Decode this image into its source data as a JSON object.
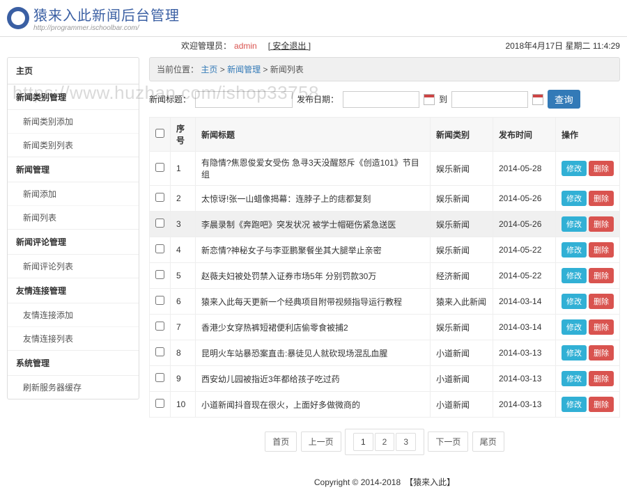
{
  "header": {
    "title": "猿来入此新闻后台管理",
    "url": "http://programmer.ischoolbar.com/"
  },
  "welcome": {
    "prefix": "欢迎管理员：",
    "admin": "admin",
    "logout": "[ 安全退出 ]",
    "datetime": "2018年4月17日 星期二 11:4:29"
  },
  "sidebar": {
    "home": "主页",
    "groups": [
      {
        "title": "新闻类别管理",
        "items": [
          "新闻类别添加",
          "新闻类别列表"
        ]
      },
      {
        "title": "新闻管理",
        "items": [
          "新闻添加",
          "新闻列表"
        ]
      },
      {
        "title": "新闻评论管理",
        "items": [
          "新闻评论列表"
        ]
      },
      {
        "title": "友情连接管理",
        "items": [
          "友情连接添加",
          "友情连接列表"
        ]
      },
      {
        "title": "系统管理",
        "items": [
          "刷新服务器缓存"
        ]
      }
    ]
  },
  "breadcrumb": {
    "label": "当前位置：",
    "home": "主页",
    "sep": " > ",
    "l1": "新闻管理",
    "l2": "新闻列表"
  },
  "search": {
    "title_label": "新闻标题：",
    "title_value": "",
    "date_label": "发布日期：",
    "date_from": "",
    "to_label": "到",
    "date_to": "",
    "query": "查询"
  },
  "table": {
    "headers": {
      "chk": "",
      "idx": "序号",
      "title": "新闻标题",
      "cat": "新闻类别",
      "date": "发布时间",
      "ops": "操作"
    },
    "ops": {
      "edit": "修改",
      "del": "删除"
    },
    "rows": [
      {
        "idx": "1",
        "title": "有隐情?焦恩俊爱女受伤 急寻3天没醒怒斥《创造101》节目组",
        "cat": "娱乐新闻",
        "date": "2014-05-28"
      },
      {
        "idx": "2",
        "title": "太惊讶!张一山蜡像揭幕：连脖子上的痣都复刻",
        "cat": "娱乐新闻",
        "date": "2014-05-26"
      },
      {
        "idx": "3",
        "title": "李晨录制《奔跑吧》突发状况 被学士帽砸伤紧急送医",
        "cat": "娱乐新闻",
        "date": "2014-05-26",
        "hl": true
      },
      {
        "idx": "4",
        "title": "新恋情?神秘女子与李亚鹏聚餐坐其大腿举止亲密",
        "cat": "娱乐新闻",
        "date": "2014-05-22"
      },
      {
        "idx": "5",
        "title": "赵薇夫妇被处罚禁入证券市场5年 分别罚款30万",
        "cat": "经济新闻",
        "date": "2014-05-22"
      },
      {
        "idx": "6",
        "title": "猿来入此每天更新一个经典项目附带视频指导运行教程",
        "cat": "猿来入此新闻",
        "date": "2014-03-14"
      },
      {
        "idx": "7",
        "title": "香港少女穿热裤短裙便利店偷零食被捕2",
        "cat": "娱乐新闻",
        "date": "2014-03-14"
      },
      {
        "idx": "8",
        "title": "昆明火车站暴恐案直击:暴徒见人就砍现场混乱血腥",
        "cat": "小道新闻",
        "date": "2014-03-13"
      },
      {
        "idx": "9",
        "title": "西安幼儿园被指近3年都给孩子吃过药",
        "cat": "小道新闻",
        "date": "2014-03-13"
      },
      {
        "idx": "10",
        "title": "小道新闻抖音现在很火，上面好多做微商的",
        "cat": "小道新闻",
        "date": "2014-03-13"
      }
    ]
  },
  "pager": {
    "first": "首页",
    "prev": "上一页",
    "pages": [
      "1",
      "2",
      "3"
    ],
    "next": "下一页",
    "last": "尾页",
    "current": "1"
  },
  "footer": {
    "copy": "Copyright © 2014-2018　【猿来入此】"
  },
  "watermark": "https://www.huzhan.com/ishop33758"
}
